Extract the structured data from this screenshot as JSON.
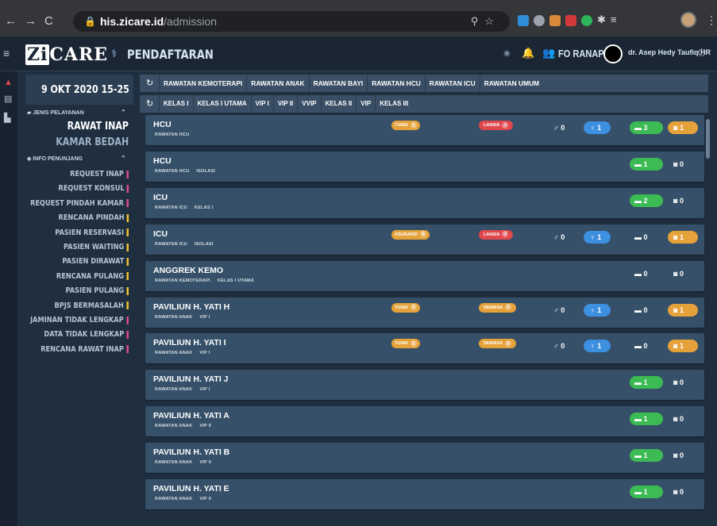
{
  "browser": {
    "url_host": "his.zicare.id",
    "url_path": "/admission"
  },
  "header": {
    "logo": "ZiCare",
    "logo_zi": "Zi",
    "logo_rest": "CARE",
    "page_title": "PENDAFTARAN",
    "role": "FO RANAP",
    "doctor": "dr. Asep Hedy Taufiq HR"
  },
  "sidebar": {
    "datetime": "9 OKT 2020 15-25",
    "section_service": "JENIS PELAYANAN",
    "services": [
      "RAWAT INAP",
      "KAMAR BEDAH"
    ],
    "section_info": "INFO PENUNJANG",
    "menu": [
      {
        "label": "REQUEST INAP",
        "color": "#e04b8f"
      },
      {
        "label": "REQUEST KONSUL",
        "color": "#e04b8f"
      },
      {
        "label": "REQUEST PINDAH KAMAR",
        "color": "#e04b8f"
      },
      {
        "label": "RENCANA PINDAH",
        "color": "#f2c22e"
      },
      {
        "label": "PASIEN RESERVASI",
        "color": "#f2c22e"
      },
      {
        "label": "PASIEN WAITING",
        "color": "#f2c22e"
      },
      {
        "label": "PASIEN DIRAWAT",
        "color": "#f2c22e"
      },
      {
        "label": "RENCANA PULANG",
        "color": "#f2c22e"
      },
      {
        "label": "PASIEN PULANG",
        "color": "#f2c22e"
      },
      {
        "label": "BPJS BERMASALAH",
        "color": "#f2c22e"
      },
      {
        "label": "JAMINAN TIDAK LENGKAP",
        "color": "#e04b8f"
      },
      {
        "label": "DATA TIDAK LENGKAP",
        "color": "#e04b8f"
      },
      {
        "label": "RENCANA RAWAT INAP",
        "color": "#e04b8f"
      }
    ]
  },
  "tabs": {
    "care_types": [
      "RAWATAN KEMOTERAPI",
      "RAWATAN ANAK",
      "RAWATAN BAYI",
      "RAWATAN HCU",
      "RAWATAN ICU",
      "RAWATAN UMUM"
    ],
    "classes": [
      "KELAS I",
      "KELAS I UTAMA",
      "VIP I",
      "VIP II",
      "VVIP",
      "KELAS II",
      "VIP",
      "KELAS III"
    ]
  },
  "rooms": [
    {
      "name": "HCU",
      "tags": [
        "RAWATAN HCU"
      ],
      "payment": "TUNAI",
      "payment_count": "1",
      "age": "LANSIA",
      "age_count": "1",
      "age_color": "#e0474c",
      "male": "0",
      "female": "1",
      "beds": "3",
      "beds_color": "#3cba54",
      "occupied": "1",
      "occupied_color": "#e5a13a"
    },
    {
      "name": "HCU",
      "tags": [
        "RAWATAN HCU",
        "ISOLASI"
      ],
      "beds": "1",
      "beds_color": "#3cba54",
      "occupied": "0"
    },
    {
      "name": "ICU",
      "tags": [
        "RAWATAN ICU",
        "KELAS I"
      ],
      "beds": "2",
      "beds_color": "#3cba54",
      "occupied": "0"
    },
    {
      "name": "ICU",
      "tags": [
        "RAWATAN ICU",
        "ISOLASI"
      ],
      "payment": "ASURANSI",
      "payment_count": "1",
      "age": "LANSIA",
      "age_count": "1",
      "age_color": "#e0474c",
      "male": "0",
      "female": "1",
      "beds": "0",
      "occupied": "1",
      "occupied_color": "#e5a13a"
    },
    {
      "name": "ANGGREK KEMO",
      "tags": [
        "RAWATAN KEMOTERAPI",
        "KELAS I UTAMA"
      ],
      "beds": "0",
      "occupied": "0"
    },
    {
      "name": "PAVILIUN H. YATI H",
      "tags": [
        "RAWATAN ANAK",
        "VIP I"
      ],
      "payment": "TUNAI",
      "payment_count": "1",
      "age": "DEWASA",
      "age_count": "1",
      "age_color": "#e5a13a",
      "male": "0",
      "female": "1",
      "beds": "0",
      "occupied": "1",
      "occupied_color": "#e5a13a"
    },
    {
      "name": "PAVILIUN H. YATI I",
      "tags": [
        "RAWATAN ANAK",
        "VIP I"
      ],
      "payment": "TUNAI",
      "payment_count": "1",
      "age": "DEWASA",
      "age_count": "1",
      "age_color": "#e5a13a",
      "male": "0",
      "female": "1",
      "beds": "0",
      "occupied": "1",
      "occupied_color": "#e5a13a"
    },
    {
      "name": "PAVILIUN H. YATI J",
      "tags": [
        "RAWATAN ANAK",
        "VIP I"
      ],
      "beds": "1",
      "beds_color": "#3cba54",
      "occupied": "0"
    },
    {
      "name": "PAVILIUN H. YATI A",
      "tags": [
        "RAWATAN ANAK",
        "VIP II"
      ],
      "beds": "1",
      "beds_color": "#3cba54",
      "occupied": "0"
    },
    {
      "name": "PAVILIUN H. YATI B",
      "tags": [
        "RAWATAN ANAK",
        "VIP II"
      ],
      "beds": "1",
      "beds_color": "#3cba54",
      "occupied": "0"
    },
    {
      "name": "PAVILIUN H. YATI E",
      "tags": [
        "RAWATAN ANAK",
        "VIP II"
      ],
      "beds": "1",
      "beds_color": "#3cba54",
      "occupied": "0"
    }
  ]
}
